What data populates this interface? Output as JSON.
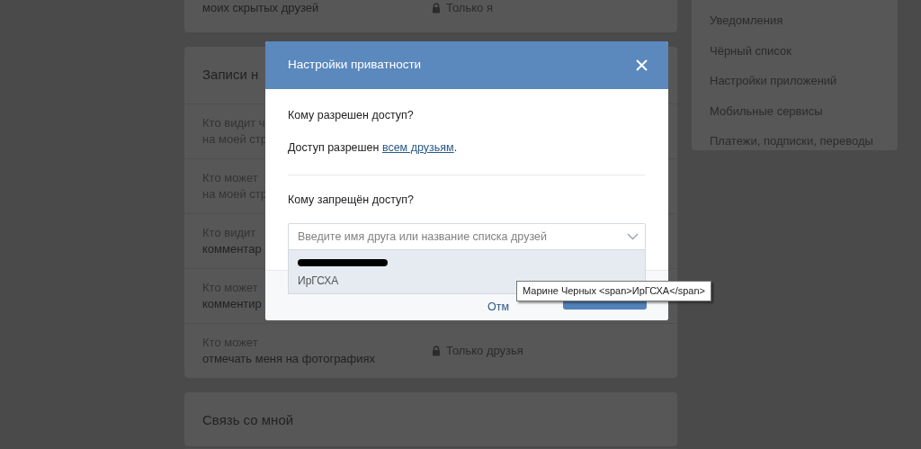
{
  "privacy_page": {
    "sections": [
      {
        "rows": [
          {
            "lines": [
              {
                "text": "моих скрытых друзей",
                "strong": true
              }
            ],
            "value": "Только я"
          }
        ]
      },
      {
        "title": "Записи н",
        "rows": [
          {
            "lines": [
              {
                "text": "Кто видит ч",
                "strong": false
              },
              {
                "text": "на моей стр",
                "strong": false
              }
            ]
          },
          {
            "lines": [
              {
                "text": "Кто может",
                "strong": false
              },
              {
                "text": "на моей стр",
                "strong": false
              }
            ]
          },
          {
            "lines": [
              {
                "text": "Кто видит",
                "strong": false
              },
              {
                "text": "комментар",
                "strong": true
              }
            ]
          },
          {
            "lines": [
              {
                "text": "Кто может",
                "strong": false
              },
              {
                "text": "комментир",
                "strong": true
              }
            ]
          },
          {
            "lines": [
              {
                "text": "Кто может",
                "strong": false
              },
              {
                "text": "отмечать меня на фотографиях",
                "strong": true
              }
            ],
            "value": "Только друзья"
          }
        ]
      },
      {
        "title": "Связь со мной"
      }
    ]
  },
  "settings_menu": {
    "items": [
      "Уведомления",
      "Чёрный список",
      "Настройки приложений",
      "Мобильные сервисы",
      "Платежи, подписки, переводы"
    ]
  },
  "modal": {
    "title": "Настройки приватности",
    "allowed_heading": "Кому разрешен доступ?",
    "allowed_text": "Доступ разрешен ",
    "allowed_link": "всем друзьям",
    "allowed_end": ".",
    "denied_heading": "Кому запрещён доступ?",
    "search": {
      "placeholder": "Введите имя друга или название списка друзей"
    },
    "suggestions": [
      {
        "redacted": true,
        "subtitle": "ИрГСХА",
        "selected": true
      }
    ],
    "cancel": "Отм"
  },
  "tooltip": "Марине Черных <span>ИрГСХА</span>"
}
